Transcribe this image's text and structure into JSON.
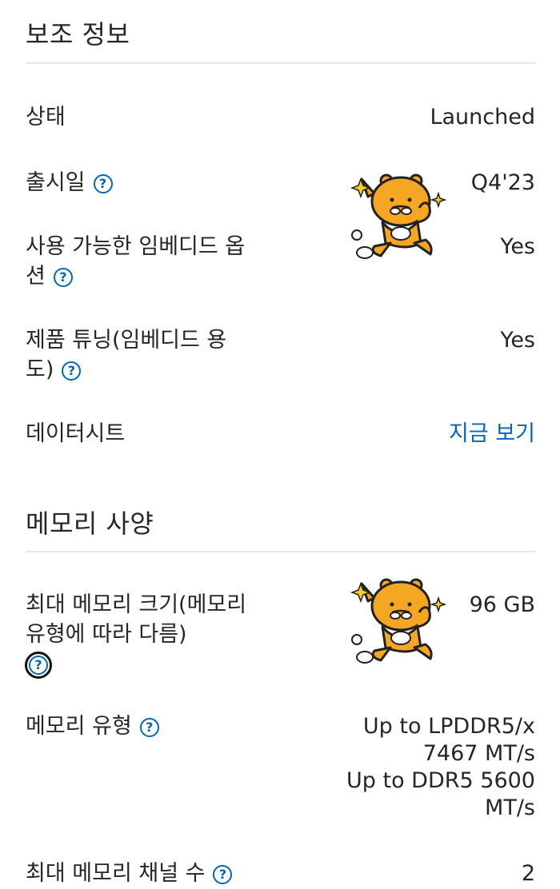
{
  "supplemental": {
    "title": "보조 정보",
    "rows": [
      {
        "label": "상태",
        "value": "Launched"
      },
      {
        "label": "출시일",
        "value": "Q4'23"
      },
      {
        "label": "사용 가능한 임베디드 옵션",
        "value": "Yes"
      },
      {
        "label": "제품 튜닝(임베디드 용도)",
        "value": "Yes"
      },
      {
        "label": "데이터시트",
        "value": "지금 보기"
      }
    ]
  },
  "memory": {
    "title": "메모리 사양",
    "rows": [
      {
        "label": "최대 메모리 크기(메모리 유형에 따라 다름)",
        "value": "96 GB"
      },
      {
        "label": "메모리 유형",
        "value_lines": [
          "Up to LPDDR5/x",
          "7467 MT/s",
          "Up to DDR5 5600",
          "MT/s"
        ]
      },
      {
        "label": "최대 메모리 채널 수",
        "value": "2"
      }
    ]
  },
  "help_glyph": "?",
  "colors": {
    "link": "#0068b5",
    "text": "#262626",
    "divider": "#e6e6e6",
    "sticker_body": "#f5a623"
  }
}
